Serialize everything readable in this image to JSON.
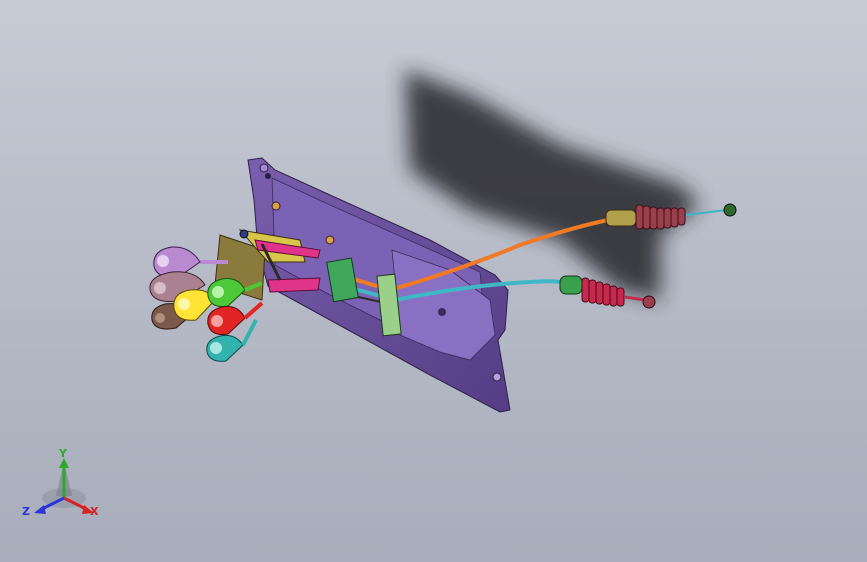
{
  "viewport": {
    "background_top": "#c6cbd6",
    "background_bottom": "#a7adba"
  },
  "model": {
    "bracket_color": "#6a4f9a",
    "cable_colors": [
      "#f07a26",
      "#3fb7c4"
    ],
    "boot_colors": [
      "#9c3f4d",
      "#c7284d"
    ],
    "knob_colors": [
      "#b98ad0",
      "#a98190",
      "#ffe436",
      "#7b5a4b",
      "#4cc839",
      "#e12424",
      "#33b3ad"
    ]
  },
  "triad": {
    "y_label": "Y",
    "z_label": "Z",
    "x_label": "X",
    "icons": [
      "coordinate-triad-icon"
    ]
  }
}
